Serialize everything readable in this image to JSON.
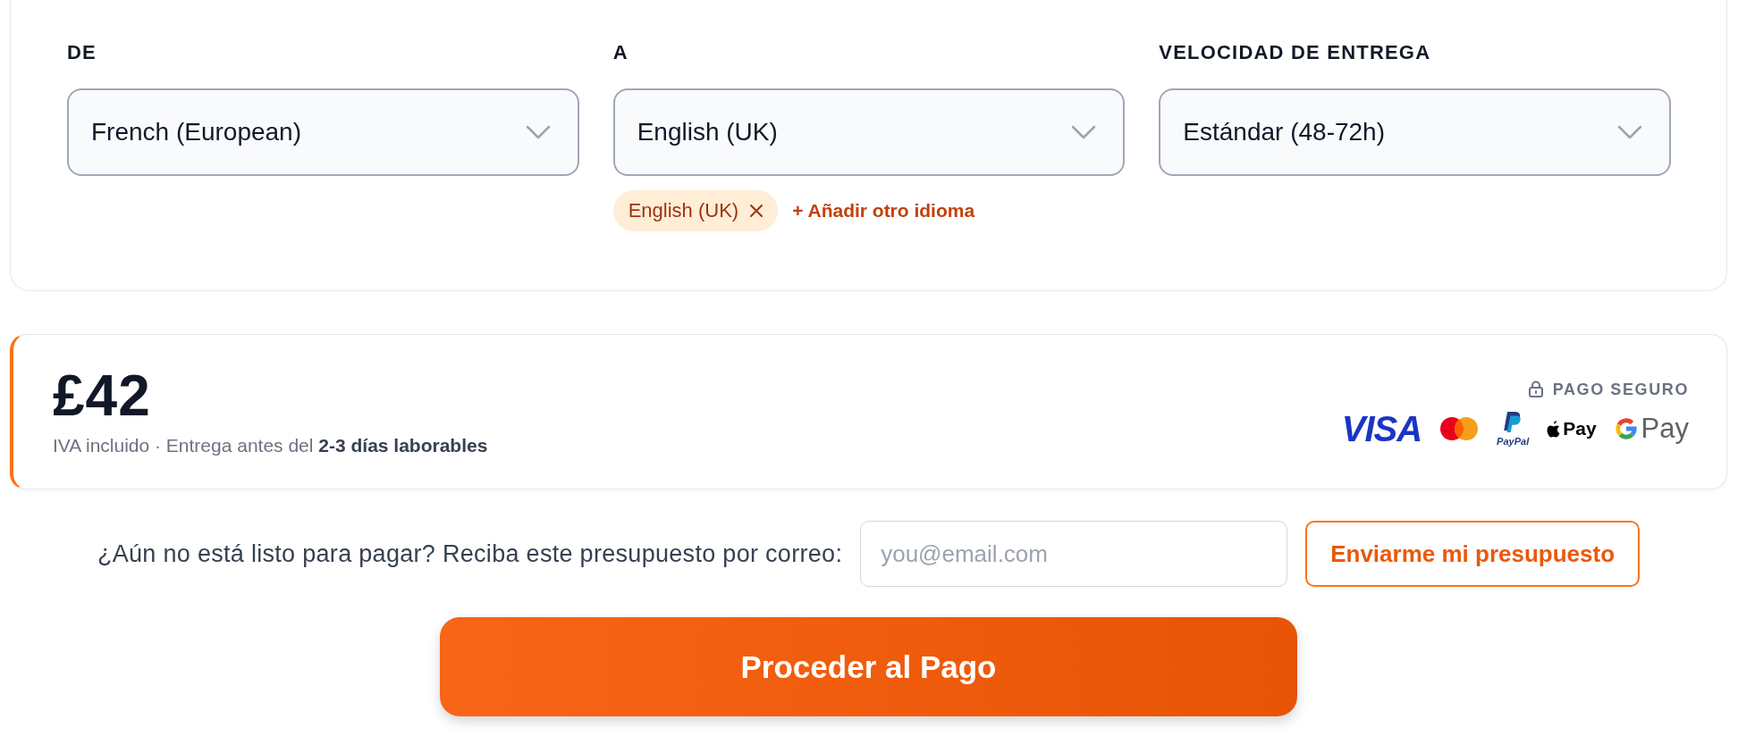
{
  "fields": [
    {
      "label": "DE",
      "value": "French (European)"
    },
    {
      "label": "A",
      "value": "English (UK)",
      "tags": [
        {
          "label": "English (UK)"
        }
      ],
      "add_link": "+ Añadir otro idioma"
    },
    {
      "label": "VELOCIDAD DE ENTREGA",
      "value": "Estándar (48-72h)"
    }
  ],
  "price": {
    "amount": "£42",
    "note": "IVA incluido · Entrega antes del **2-3 días laborables**",
    "secure_label": "PAGO SEGURO",
    "payment_methods": [
      {
        "kind": "visa",
        "text": "VISA"
      },
      {
        "kind": "mastercard"
      },
      {
        "kind": "paypal",
        "text": "PayPal"
      },
      {
        "kind": "applepay",
        "text": "Pay"
      },
      {
        "kind": "googlepay",
        "text": "Pay"
      }
    ]
  },
  "email_quote": {
    "prompt": "¿Aún no está listo para pagar? Reciba este presupuesto por correo:",
    "placeholder": "you@email.com",
    "button": "Enviarme mi presupuesto"
  },
  "checkout_button": "Proceder al Pago"
}
